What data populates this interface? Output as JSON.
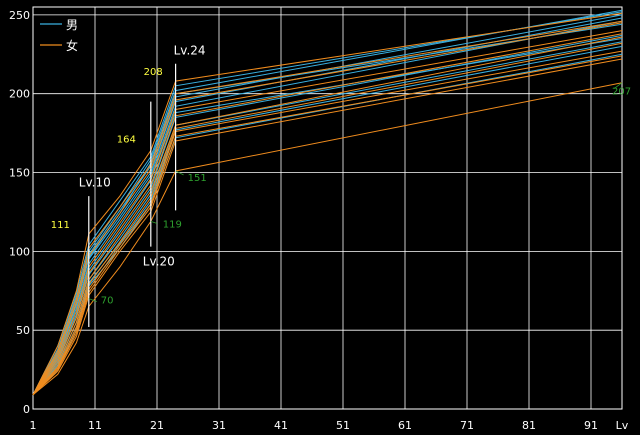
{
  "chart_data": {
    "type": "line",
    "xlim": [
      1,
      96
    ],
    "ylim": [
      0,
      255
    ],
    "x_ticks": [
      1,
      11,
      21,
      31,
      41,
      51,
      61,
      71,
      81,
      91
    ],
    "y_ticks": [
      0,
      50,
      100,
      150,
      200,
      250
    ],
    "xlabel": "Lv",
    "grid": true,
    "legend": {
      "position": "top-left",
      "entries": [
        {
          "label": "男",
          "color": "#3ab0e0"
        },
        {
          "label": "女",
          "color": "#f08c1e"
        }
      ]
    },
    "colors": {
      "male": "#3ab0e0",
      "female": "#f08c1e",
      "yellow_label": "#ffff40",
      "green_label": "#2ea02e"
    },
    "series": [
      {
        "group": "male",
        "values": [
          [
            1,
            9
          ],
          [
            5,
            38
          ],
          [
            8,
            72
          ],
          [
            10,
            100
          ],
          [
            15,
            128
          ],
          [
            20,
            158
          ],
          [
            24,
            202
          ],
          [
            96,
            253
          ]
        ]
      },
      {
        "group": "male",
        "values": [
          [
            1,
            9
          ],
          [
            5,
            40
          ],
          [
            8,
            74
          ],
          [
            10,
            104
          ],
          [
            15,
            132
          ],
          [
            20,
            160
          ],
          [
            24,
            205
          ],
          [
            96,
            252
          ]
        ]
      },
      {
        "group": "male",
        "values": [
          [
            1,
            9
          ],
          [
            5,
            36
          ],
          [
            8,
            70
          ],
          [
            10,
            98
          ],
          [
            15,
            126
          ],
          [
            20,
            154
          ],
          [
            24,
            198
          ],
          [
            96,
            250
          ]
        ]
      },
      {
        "group": "male",
        "values": [
          [
            1,
            9
          ],
          [
            5,
            34
          ],
          [
            8,
            66
          ],
          [
            10,
            95
          ],
          [
            15,
            122
          ],
          [
            20,
            150
          ],
          [
            24,
            195
          ],
          [
            96,
            248
          ]
        ]
      },
      {
        "group": "male",
        "values": [
          [
            1,
            9
          ],
          [
            5,
            33
          ],
          [
            8,
            64
          ],
          [
            10,
            92
          ],
          [
            15,
            120
          ],
          [
            20,
            148
          ],
          [
            24,
            192
          ],
          [
            96,
            246
          ]
        ]
      },
      {
        "group": "male",
        "values": [
          [
            1,
            9
          ],
          [
            5,
            30
          ],
          [
            8,
            58
          ],
          [
            10,
            85
          ],
          [
            15,
            112
          ],
          [
            20,
            140
          ],
          [
            24,
            185
          ],
          [
            96,
            237
          ]
        ]
      },
      {
        "group": "male",
        "values": [
          [
            1,
            9
          ],
          [
            5,
            32
          ],
          [
            8,
            60
          ],
          [
            10,
            88
          ],
          [
            15,
            116
          ],
          [
            20,
            145
          ],
          [
            24,
            188
          ],
          [
            96,
            235
          ]
        ]
      },
      {
        "group": "male",
        "values": [
          [
            1,
            9
          ],
          [
            5,
            28
          ],
          [
            8,
            55
          ],
          [
            10,
            82
          ],
          [
            15,
            108
          ],
          [
            20,
            136
          ],
          [
            24,
            180
          ],
          [
            96,
            233
          ]
        ]
      },
      {
        "group": "male",
        "values": [
          [
            1,
            9
          ],
          [
            5,
            27
          ],
          [
            8,
            52
          ],
          [
            10,
            80
          ],
          [
            15,
            105
          ],
          [
            20,
            132
          ],
          [
            24,
            177
          ],
          [
            96,
            230
          ]
        ]
      },
      {
        "group": "male",
        "values": [
          [
            1,
            9
          ],
          [
            5,
            25
          ],
          [
            8,
            50
          ],
          [
            10,
            78
          ],
          [
            15,
            102
          ],
          [
            20,
            130
          ],
          [
            24,
            172
          ],
          [
            96,
            225
          ]
        ]
      },
      {
        "group": "male",
        "values": [
          [
            1,
            9
          ],
          [
            5,
            35
          ],
          [
            8,
            68
          ],
          [
            10,
            96
          ],
          [
            15,
            124
          ],
          [
            20,
            156
          ],
          [
            24,
            200
          ],
          [
            96,
            244
          ]
        ]
      },
      {
        "group": "female",
        "values": [
          [
            1,
            9
          ],
          [
            5,
            40
          ],
          [
            8,
            75
          ],
          [
            10,
            111
          ],
          [
            15,
            135
          ],
          [
            20,
            164
          ],
          [
            24,
            208
          ],
          [
            96,
            251
          ]
        ]
      },
      {
        "group": "female",
        "values": [
          [
            1,
            9
          ],
          [
            5,
            37
          ],
          [
            8,
            70
          ],
          [
            10,
            102
          ],
          [
            15,
            128
          ],
          [
            20,
            155
          ],
          [
            24,
            200
          ],
          [
            96,
            246
          ]
        ]
      },
      {
        "group": "female",
        "values": [
          [
            1,
            9
          ],
          [
            5,
            35
          ],
          [
            8,
            67
          ],
          [
            10,
            97
          ],
          [
            15,
            124
          ],
          [
            20,
            152
          ],
          [
            24,
            196
          ],
          [
            96,
            245
          ]
        ]
      },
      {
        "group": "female",
        "values": [
          [
            1,
            9
          ],
          [
            5,
            33
          ],
          [
            8,
            62
          ],
          [
            10,
            90
          ],
          [
            15,
            118
          ],
          [
            20,
            146
          ],
          [
            24,
            190
          ],
          [
            96,
            240
          ]
        ]
      },
      {
        "group": "female",
        "values": [
          [
            1,
            9
          ],
          [
            5,
            31
          ],
          [
            8,
            58
          ],
          [
            10,
            86
          ],
          [
            15,
            114
          ],
          [
            20,
            142
          ],
          [
            24,
            186
          ],
          [
            96,
            238
          ]
        ]
      },
      {
        "group": "female",
        "values": [
          [
            1,
            9
          ],
          [
            5,
            29
          ],
          [
            8,
            55
          ],
          [
            10,
            82
          ],
          [
            15,
            110
          ],
          [
            20,
            138
          ],
          [
            24,
            180
          ],
          [
            96,
            236
          ]
        ]
      },
      {
        "group": "female",
        "values": [
          [
            1,
            9
          ],
          [
            5,
            27
          ],
          [
            8,
            52
          ],
          [
            10,
            79
          ],
          [
            15,
            106
          ],
          [
            20,
            134
          ],
          [
            24,
            178
          ],
          [
            96,
            232
          ]
        ]
      },
      {
        "group": "female",
        "values": [
          [
            1,
            9
          ],
          [
            5,
            26
          ],
          [
            8,
            50
          ],
          [
            10,
            76
          ],
          [
            15,
            104
          ],
          [
            20,
            130
          ],
          [
            24,
            176
          ],
          [
            96,
            227
          ]
        ]
      },
      {
        "group": "female",
        "values": [
          [
            1,
            9
          ],
          [
            5,
            25
          ],
          [
            8,
            48
          ],
          [
            10,
            74
          ],
          [
            15,
            102
          ],
          [
            20,
            128
          ],
          [
            24,
            173
          ],
          [
            96,
            224
          ]
        ]
      },
      {
        "group": "female",
        "values": [
          [
            1,
            9
          ],
          [
            5,
            24
          ],
          [
            8,
            46
          ],
          [
            10,
            72
          ],
          [
            15,
            100
          ],
          [
            20,
            125
          ],
          [
            24,
            170
          ],
          [
            96,
            222
          ]
        ]
      },
      {
        "group": "female",
        "values": [
          [
            1,
            9
          ],
          [
            5,
            22
          ],
          [
            8,
            42
          ],
          [
            10,
            65
          ],
          [
            15,
            90
          ],
          [
            20,
            119
          ],
          [
            24,
            151
          ],
          [
            96,
            207
          ]
        ]
      }
    ],
    "annotations": {
      "level_labels": [
        {
          "text": "Lv.10",
          "x": 10
        },
        {
          "text": "Lv.20",
          "x": 20
        },
        {
          "text": "Lv.24",
          "x": 24
        }
      ],
      "level_markers": [
        {
          "x": 10,
          "from": 52,
          "to": 135
        },
        {
          "x": 20,
          "from": 103,
          "to": 195
        },
        {
          "x": 24,
          "from": 126,
          "to": 219
        }
      ],
      "values": [
        {
          "text": "111",
          "x": 10,
          "y": 111,
          "color": "yellow"
        },
        {
          "text": "164",
          "x": 20,
          "y": 164,
          "color": "yellow"
        },
        {
          "text": "208",
          "x": 24,
          "y": 208,
          "color": "yellow"
        },
        {
          "text": "70",
          "x": 10,
          "y": 70,
          "color": "green"
        },
        {
          "text": "119",
          "x": 20,
          "y": 119,
          "color": "green"
        },
        {
          "text": "151",
          "x": 24,
          "y": 151,
          "color": "green"
        },
        {
          "text": "207",
          "x": 96,
          "y": 207,
          "color": "green"
        }
      ]
    }
  }
}
